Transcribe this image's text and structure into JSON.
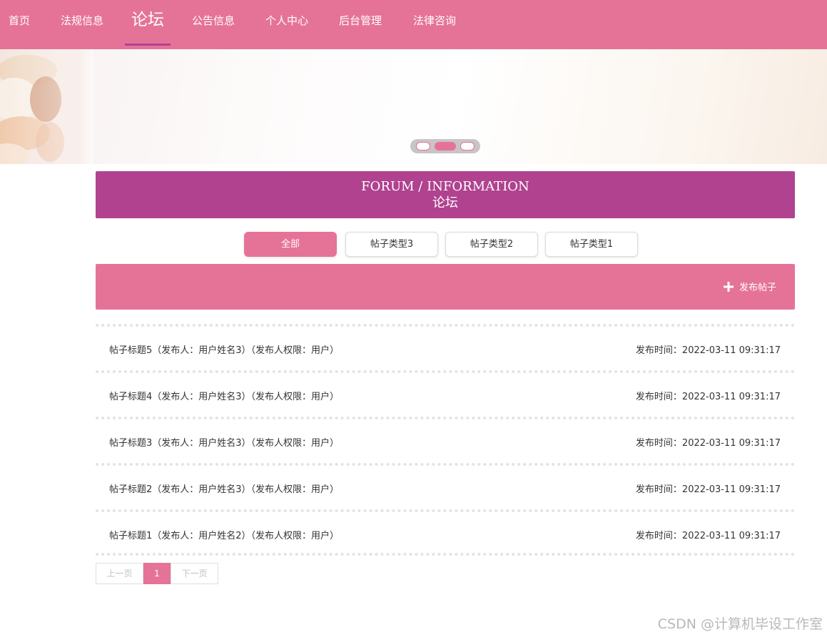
{
  "nav": {
    "items": [
      {
        "label": "首页"
      },
      {
        "label": "法规信息"
      },
      {
        "label": "论坛"
      },
      {
        "label": "公告信息"
      },
      {
        "label": "个人中心"
      },
      {
        "label": "后台管理"
      },
      {
        "label": "法律咨询"
      }
    ],
    "active_index": 2
  },
  "banner": {
    "slide_count": 3,
    "active_slide": 2
  },
  "section": {
    "title_en": "FORUM / INFORMATION",
    "title_zh": "论坛"
  },
  "tabs": [
    {
      "label": "全部",
      "active": true
    },
    {
      "label": "帖子类型3",
      "active": false
    },
    {
      "label": "帖子类型2",
      "active": false
    },
    {
      "label": "帖子类型1",
      "active": false
    }
  ],
  "action": {
    "post_label": "发布帖子",
    "icon": "plus-icon"
  },
  "posts": [
    {
      "title": "帖子标题5（发布人：用户姓名3）（发布人权限：用户）",
      "time": "发布时间：2022-03-11 09:31:17"
    },
    {
      "title": "帖子标题4（发布人：用户姓名3）（发布人权限：用户）",
      "time": "发布时间：2022-03-11 09:31:17"
    },
    {
      "title": "帖子标题3（发布人：用户姓名3）（发布人权限：用户）",
      "time": "发布时间：2022-03-11 09:31:17"
    },
    {
      "title": "帖子标题2（发布人：用户姓名3）（发布人权限：用户）",
      "time": "发布时间：2022-03-11 09:31:17"
    },
    {
      "title": "帖子标题1（发布人：用户姓名2）（发布人权限：用户）",
      "time": "发布时间：2022-03-11 09:31:17"
    }
  ],
  "pager": {
    "prev_label": "上一页",
    "current_page": "1",
    "next_label": "下一页"
  },
  "watermark": "CSDN @计算机毕设工作室",
  "colors": {
    "primary": "#e57398",
    "accent": "#b0428f",
    "text": "#333333",
    "muted": "#c0c0c0"
  }
}
